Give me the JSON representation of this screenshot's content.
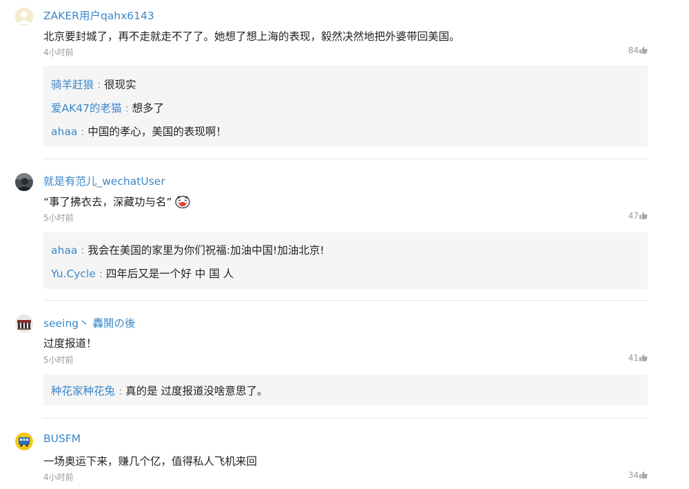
{
  "comments": [
    {
      "username": "ZAKER用户qahx6143",
      "text": "北京要封城了，再不走就走不了了。她想了想上海的表现，毅然决然地把外婆带回美国。",
      "time": "4小时前",
      "likes": "84",
      "avatar_icon": "default-user-icon",
      "replies": [
        {
          "author": "骑羊赶狼",
          "separator": " : ",
          "text": "很现实"
        },
        {
          "author": "爱AK47的老猫",
          "separator": " : ",
          "text": "想多了"
        },
        {
          "author": "ahaa",
          "separator": " : ",
          "text": "中国的孝心，美国的表现啊！"
        }
      ]
    },
    {
      "username": "就是有范儿_wechatUser",
      "text": "“事了拂衣去，深藏功与名”",
      "emoji_icon": "laughing-emoji-icon",
      "time": "5小时前",
      "likes": "47",
      "avatar_icon": "photo-avatar",
      "replies": [
        {
          "author": "ahaa",
          "separator": " : ",
          "text": "我会在美国的家里为你们祝福:加油中国!加油北京!"
        },
        {
          "author": "Yu.Cycle",
          "separator": " : ",
          "text": "四年后又是一个好 中 国 人"
        }
      ]
    },
    {
      "username": "seeing丶 轟鬨の後",
      "text": "过度报道！",
      "time": "5小时前",
      "likes": "41",
      "avatar_icon": "photo-avatar",
      "replies": [
        {
          "author": "种花家种花兔",
          "separator": " : ",
          "text": "真的是 过度报道没啥意思了。"
        }
      ]
    },
    {
      "username": "BUSFM",
      "text": "一场奥运下来，赚几个亿，值得私人飞机来回",
      "time": "4小时前",
      "likes": "34",
      "avatar_icon": "bus-logo-avatar",
      "replies": []
    }
  ],
  "like_icon": "thumbs-up-icon",
  "colors": {
    "username": "#3a87c9",
    "text": "#222222",
    "meta": "#999999",
    "reply_bg": "#f5f5f5",
    "divider": "#e6e6e6"
  }
}
